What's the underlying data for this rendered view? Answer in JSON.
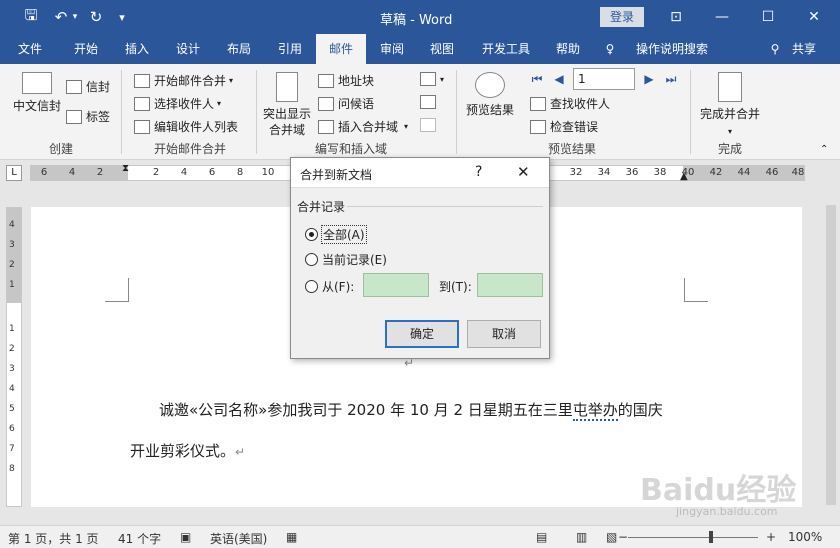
{
  "window": {
    "title": "草稿 - Word",
    "login": "登录"
  },
  "tabs": [
    {
      "label": "文件"
    },
    {
      "label": "开始"
    },
    {
      "label": "插入"
    },
    {
      "label": "设计"
    },
    {
      "label": "布局"
    },
    {
      "label": "引用"
    },
    {
      "label": "邮件"
    },
    {
      "label": "审阅"
    },
    {
      "label": "视图"
    },
    {
      "label": "开发工具"
    },
    {
      "label": "帮助"
    },
    {
      "label": "操作说明搜索"
    },
    {
      "label": "共享"
    }
  ],
  "ribbon": {
    "create": {
      "label": "创建",
      "envelope": "中文信封",
      "envelopes": "信封",
      "labels": "标签"
    },
    "start": {
      "label": "开始邮件合并",
      "start_merge": "开始邮件合并",
      "select_recipients": "选择收件人",
      "edit_list": "编辑收件人列表"
    },
    "write": {
      "label": "编写和插入域",
      "highlight_line1": "突出显示",
      "highlight_line2": "合并域",
      "address_block": "地址块",
      "greeting": "问候语",
      "insert_field": "插入合并域"
    },
    "preview": {
      "label": "预览结果",
      "preview_results": "预览结果",
      "record": "1",
      "find_recipient": "查找收件人",
      "check_errors": "检查错误"
    },
    "finish": {
      "label": "完成",
      "finish_merge": "完成并合并"
    }
  },
  "ruler": {
    "ticks": [
      "6",
      "4",
      "2",
      "2",
      "4",
      "6",
      "8",
      "10",
      "32",
      "34",
      "36",
      "38",
      "40",
      "42",
      "44",
      "46",
      "48"
    ],
    "vticks": [
      "4",
      "3",
      "2",
      "1",
      "1",
      "2",
      "3",
      "4",
      "5",
      "6",
      "7",
      "8"
    ]
  },
  "document": {
    "line1_a": "诚邀«公司名称»参加我司于 2020 年 10 月 2 日星期五在三里",
    "line1_b": "屯举办",
    "line1_c": "的国庆",
    "line2": "开业剪彩仪式。",
    "para_mark": "↵"
  },
  "dialog": {
    "title": "合并到新文档",
    "help": "?",
    "group": "合并记录",
    "all": "全部(A)",
    "current": "当前记录(E)",
    "from": "从(F):",
    "to": "到(T):",
    "ok": "确定",
    "cancel": "取消"
  },
  "status": {
    "page": "第 1 页，共 1 页",
    "words": "41 个字",
    "language": "英语(美国)",
    "zoom": "100%"
  },
  "watermark": {
    "logo": "Baidu经验",
    "url": "jingyan.baidu.com"
  }
}
